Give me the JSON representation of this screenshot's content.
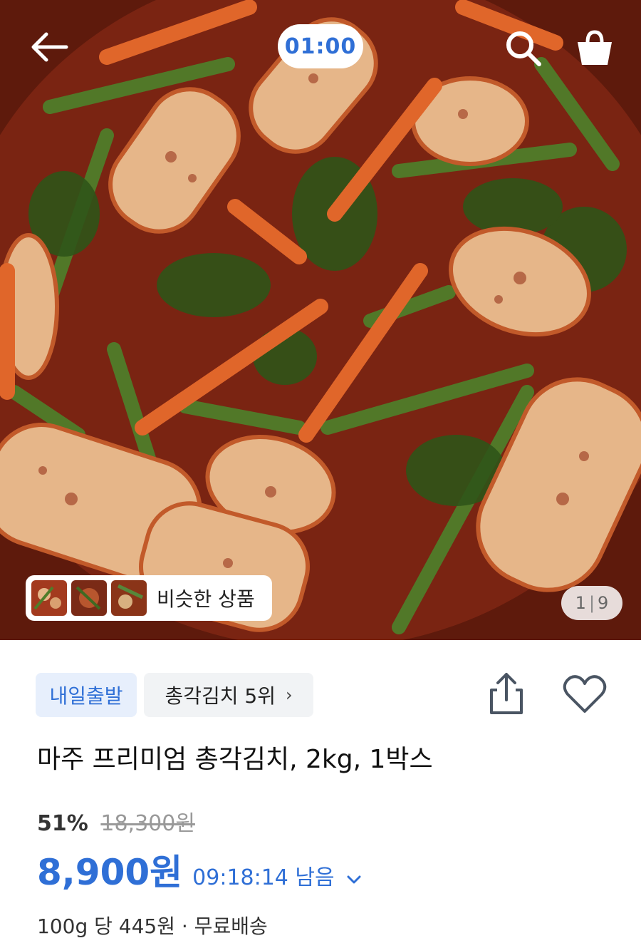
{
  "header": {
    "timer": "01:00",
    "icons": {
      "back": "arrow-left-icon",
      "search": "search-icon",
      "cart": "shopping-bag-icon"
    }
  },
  "gallery": {
    "similar_label": "비슷한 상품",
    "page_current": "1",
    "page_total": "9"
  },
  "badges": {
    "depart": "내일출발",
    "rank": "총각김치 5위",
    "rank_chevron": "›"
  },
  "actions": {
    "share_icon": "share-icon",
    "like_icon": "heart-icon"
  },
  "product": {
    "title": "마주 프리미엄 총각김치, 2kg, 1박스",
    "discount": "51%",
    "original_price": "18,300원",
    "sale_price": "8,900원",
    "remaining": "09:18:14 남음",
    "unit_info": "100g 당 445원 · 무료배송"
  },
  "colors": {
    "accent": "#2f6fd6",
    "badge_bg": "#e7effc"
  }
}
